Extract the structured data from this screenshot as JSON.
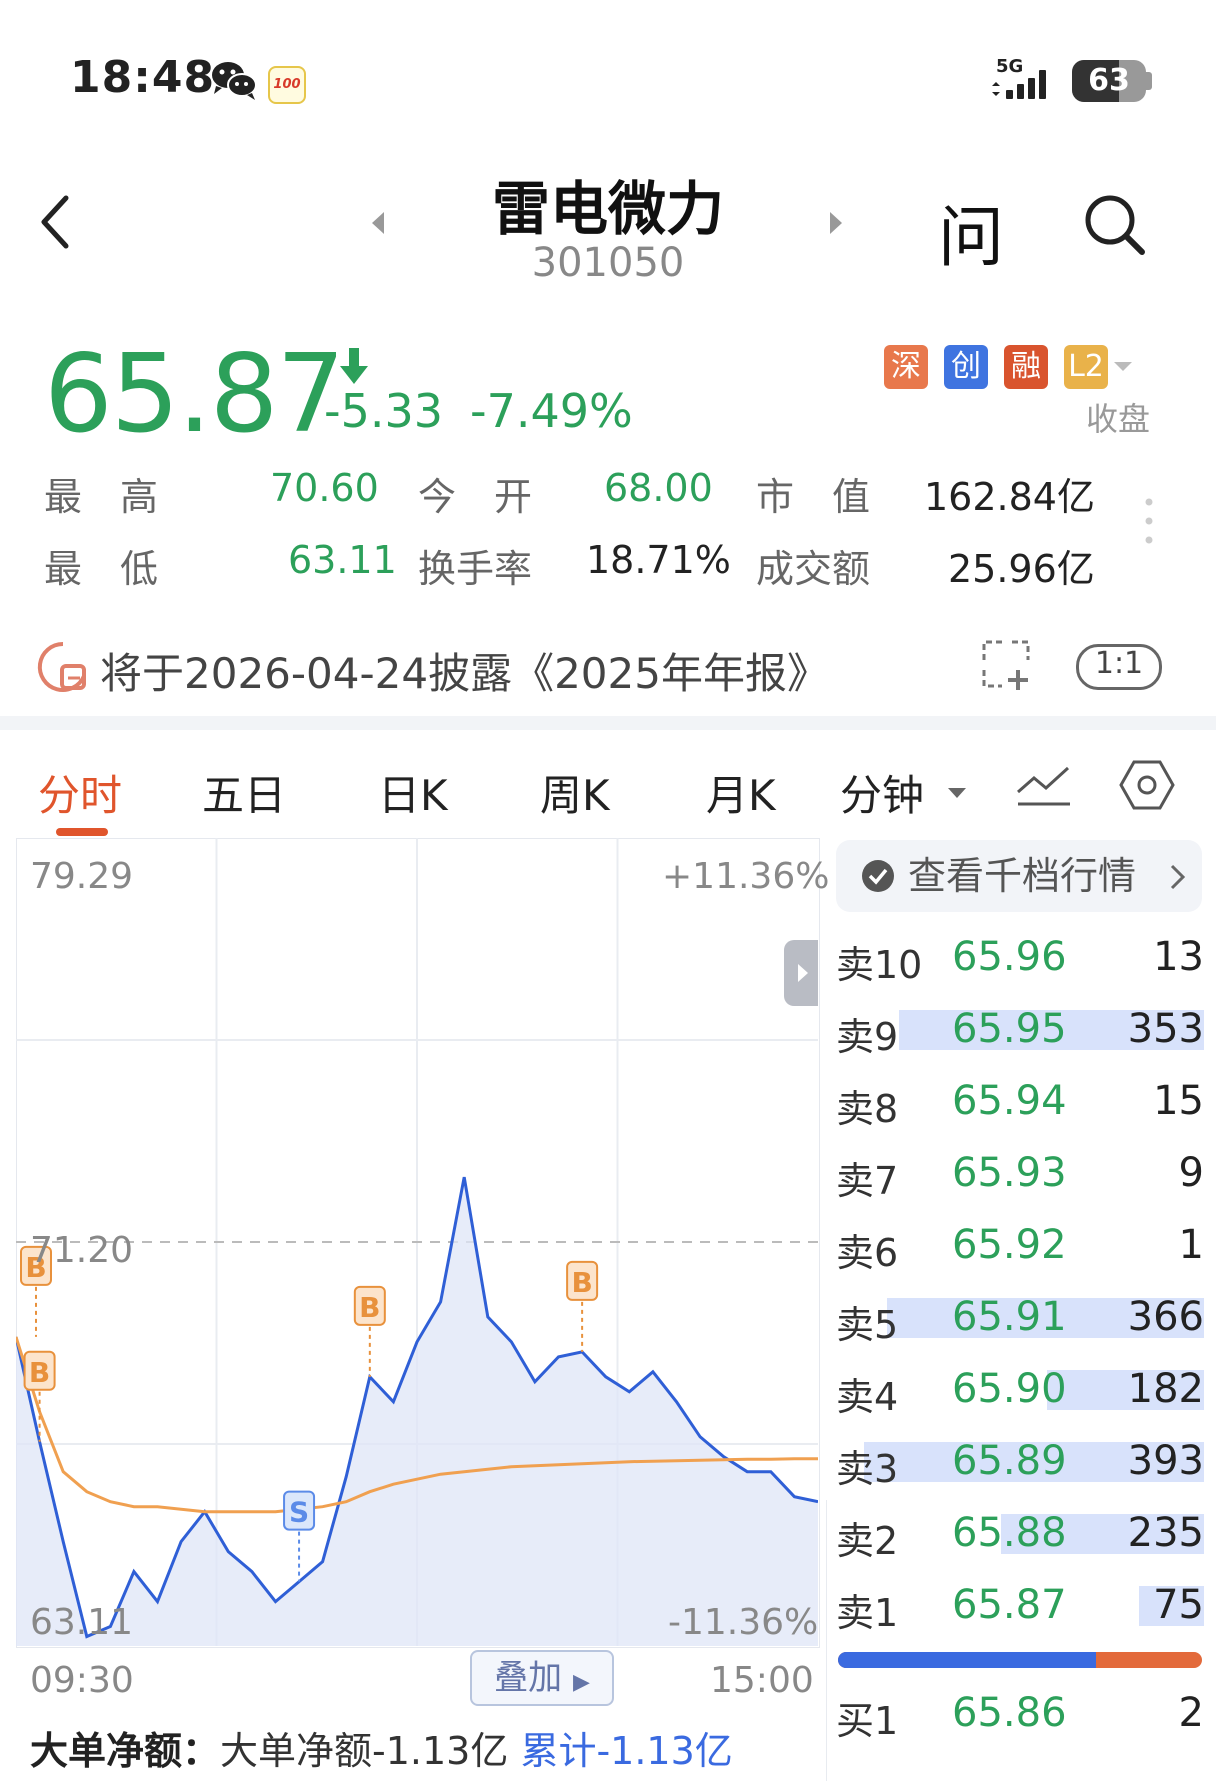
{
  "status_bar": {
    "time": "18:48",
    "network": "5G",
    "battery": "63",
    "icons": [
      "wechat-icon",
      "score-100-icon",
      "signal-icon",
      "battery-icon"
    ]
  },
  "header": {
    "stock_name": "雷电微力",
    "stock_code": "301050",
    "ask_label": "问",
    "icons": [
      "back-icon",
      "prev-stock-icon",
      "next-stock-icon",
      "search-icon"
    ]
  },
  "quote": {
    "price": "65.87",
    "change": "-5.33",
    "change_pct": "-7.49%",
    "badges": [
      "深",
      "创",
      "融",
      "L2"
    ],
    "session": "收盘",
    "high_label": "最　高",
    "high": "70.60",
    "open_label": "今　开",
    "open": "68.00",
    "mcap_label": "市　值",
    "mcap": "162.84亿",
    "low_label": "最　低",
    "low": "63.11",
    "turnover_label": "换手率",
    "turnover": "18.71%",
    "amount_label": "成交额",
    "amount": "25.96亿",
    "colors": {
      "down": "#2ca05a",
      "up": "#e0552c"
    }
  },
  "notice": {
    "text": "将于2026-04-24披露《2025年年报》",
    "ratio_label": "1:1"
  },
  "tabs": [
    {
      "label": "分时",
      "active": true
    },
    {
      "label": "五日"
    },
    {
      "label": "日K"
    },
    {
      "label": "周K"
    },
    {
      "label": "月K"
    },
    {
      "label": "分钟"
    }
  ],
  "chart": {
    "y_top": "79.29",
    "y_mid": "71.20",
    "y_bottom": "63.11",
    "pct_top": "+11.36%",
    "pct_bottom": "-11.36%",
    "x_start": "09:30",
    "x_end": "15:00",
    "overlay_label": "叠加"
  },
  "chart_data": {
    "type": "line",
    "x_range": [
      "09:30",
      "15:00"
    ],
    "ylim": [
      63.11,
      79.29
    ],
    "prev_close": 71.2,
    "series": [
      {
        "values": [
          69.3,
          67.2,
          65.2,
          63.3,
          63.5,
          64.6,
          64.0,
          65.2,
          65.8,
          65.0,
          64.6,
          64.0,
          64.4,
          64.8,
          66.5,
          68.5,
          68.0,
          69.2,
          70.0,
          72.5,
          69.7,
          69.2,
          68.4,
          68.9,
          69.0,
          68.5,
          68.2,
          68.6,
          68.0,
          67.3,
          66.9,
          66.6,
          66.6,
          66.1,
          66.0
        ]
      },
      {
        "values": [
          69.3,
          67.8,
          66.6,
          66.2,
          66.0,
          65.9,
          65.9,
          65.85,
          65.8,
          65.8,
          65.8,
          65.8,
          65.85,
          65.9,
          66.0,
          66.2,
          66.35,
          66.45,
          66.55,
          66.6,
          66.65,
          66.7,
          66.72,
          66.74,
          66.76,
          66.78,
          66.8,
          66.81,
          66.82,
          66.83,
          66.84,
          66.85,
          66.85,
          66.86,
          66.86
        ]
      }
    ],
    "markers": [
      {
        "label": "B",
        "index": 0
      },
      {
        "label": "B",
        "index": 1
      },
      {
        "label": "S",
        "index": 12
      },
      {
        "label": "B",
        "index": 15
      },
      {
        "label": "B",
        "index": 24
      }
    ]
  },
  "order_book": {
    "header": "查看千档行情",
    "asks": [
      {
        "label": "卖10",
        "price": "65.96",
        "volume": "13"
      },
      {
        "label": "卖9",
        "price": "65.95",
        "volume": "353"
      },
      {
        "label": "卖8",
        "price": "65.94",
        "volume": "15"
      },
      {
        "label": "卖7",
        "price": "65.93",
        "volume": "9"
      },
      {
        "label": "卖6",
        "price": "65.92",
        "volume": "1"
      },
      {
        "label": "卖5",
        "price": "65.91",
        "volume": "366"
      },
      {
        "label": "卖4",
        "price": "65.90",
        "volume": "182"
      },
      {
        "label": "卖3",
        "price": "65.89",
        "volume": "393"
      },
      {
        "label": "卖2",
        "price": "65.88",
        "volume": "235"
      },
      {
        "label": "卖1",
        "price": "65.87",
        "volume": "75"
      }
    ],
    "bid_ask_ratio": 0.71,
    "bids": [
      {
        "label": "买1",
        "price": "65.86",
        "volume": "2"
      }
    ]
  },
  "big_order": {
    "title": "大单净额：",
    "net": "大单净额-1.13亿",
    "cumulative": "累计-1.13亿"
  }
}
